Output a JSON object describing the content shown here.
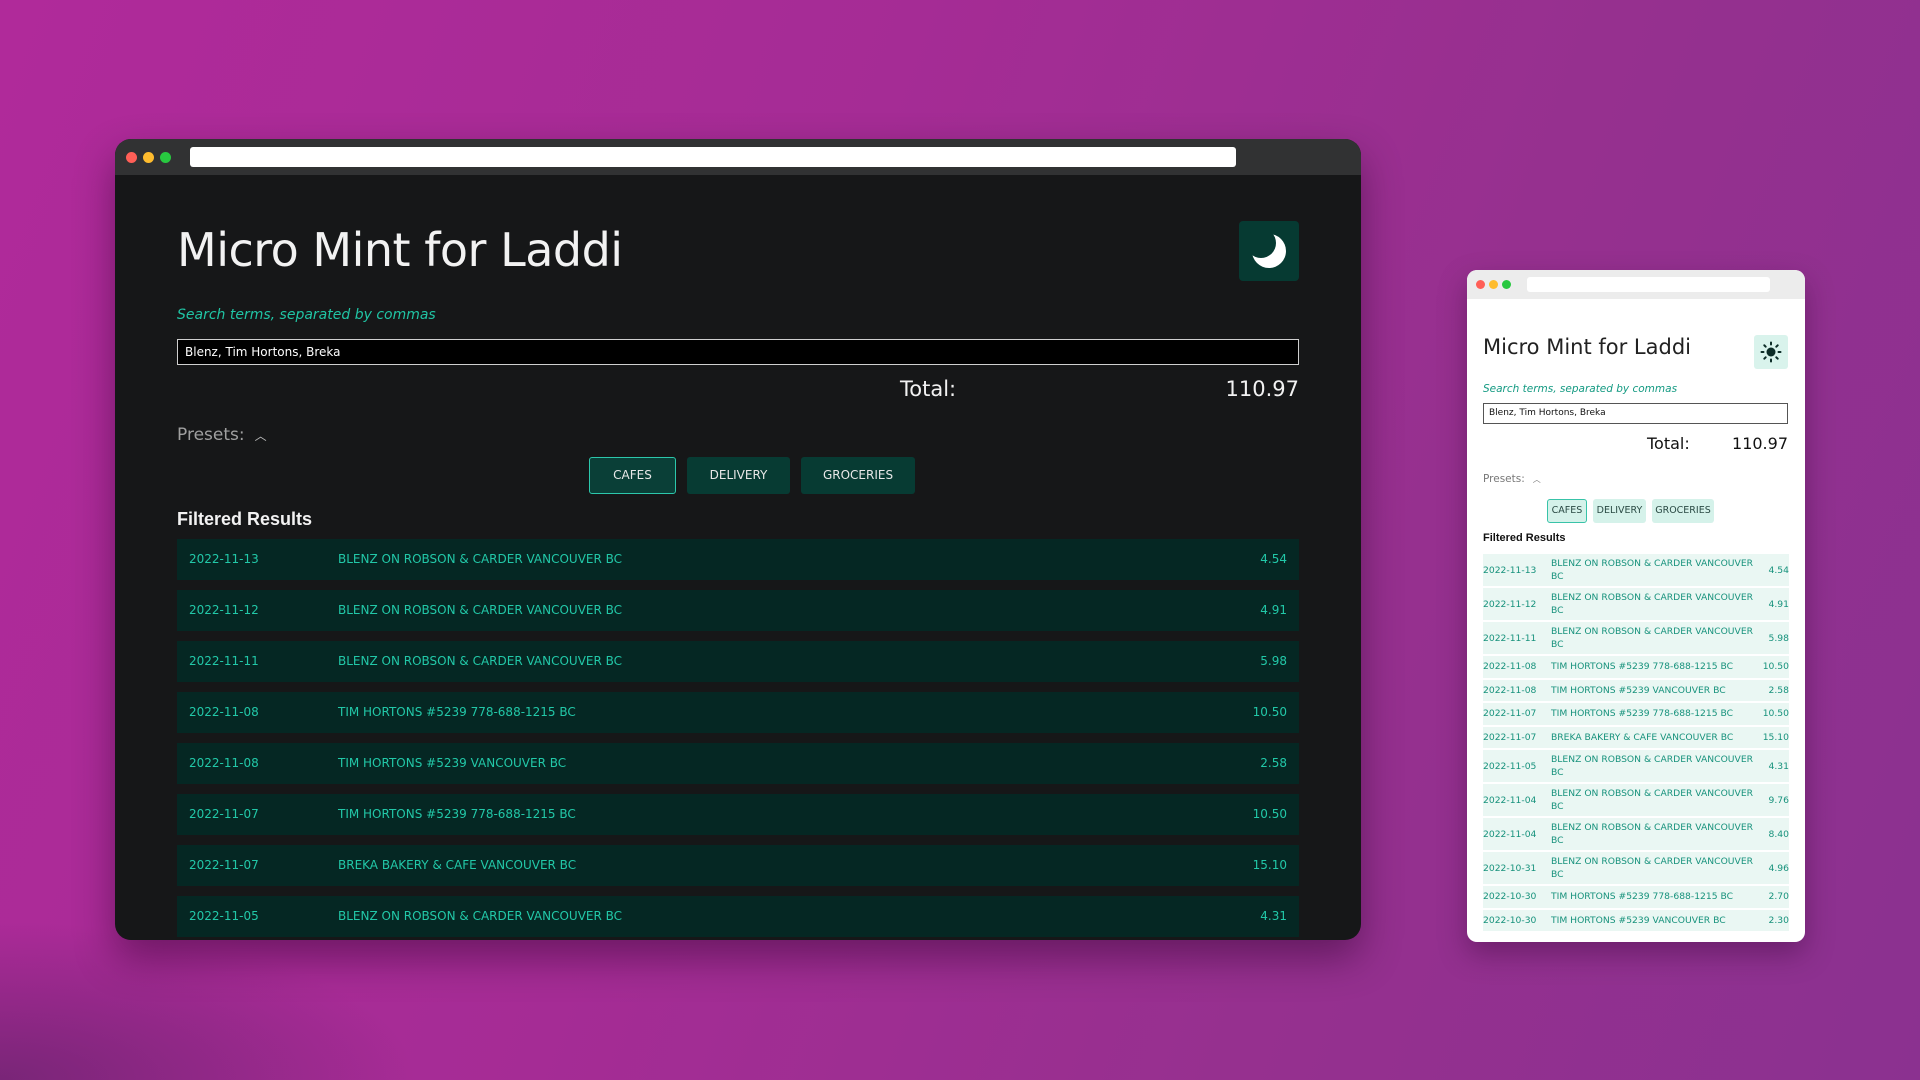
{
  "app": {
    "title": "Micro Mint for Laddi",
    "search_hint": "Search terms, separated by commas",
    "search_value": "Blenz, Tim Hortons, Breka",
    "total_label": "Total:",
    "total_value": "110.97",
    "presets_label": "Presets:",
    "presets_toggle_icon": "chevron-up-icon",
    "preset_buttons": [
      "CAFES",
      "DELIVERY",
      "GROCERIES"
    ],
    "active_preset": "CAFES",
    "results_title": "Filtered Results"
  },
  "dark_theme_icon": "moon-icon",
  "light_theme_icon": "sun-icon",
  "colors": {
    "background_gradient": [
      "#b02a9a",
      "#8b3190"
    ],
    "dark_bg": "#161718",
    "dark_row_bg": "#052723",
    "accent": "#22c8a8",
    "button_bg": "#073b33",
    "light_button_bg": "#d5f2ea",
    "light_row_bg": "#eaf7f3"
  },
  "dark_rows": [
    {
      "date": "2022-11-13",
      "desc": "BLENZ ON ROBSON & CARDER VANCOUVER BC",
      "amount": "4.54"
    },
    {
      "date": "2022-11-12",
      "desc": "BLENZ ON ROBSON & CARDER VANCOUVER BC",
      "amount": "4.91"
    },
    {
      "date": "2022-11-11",
      "desc": "BLENZ ON ROBSON & CARDER VANCOUVER BC",
      "amount": "5.98"
    },
    {
      "date": "2022-11-08",
      "desc": "TIM HORTONS #5239 778-688-1215 BC",
      "amount": "10.50"
    },
    {
      "date": "2022-11-08",
      "desc": "TIM HORTONS #5239 VANCOUVER BC",
      "amount": "2.58"
    },
    {
      "date": "2022-11-07",
      "desc": "TIM HORTONS #5239 778-688-1215 BC",
      "amount": "10.50"
    },
    {
      "date": "2022-11-07",
      "desc": "BREKA BAKERY & CAFE VANCOUVER BC",
      "amount": "15.10"
    },
    {
      "date": "2022-11-05",
      "desc": "BLENZ ON ROBSON & CARDER VANCOUVER BC",
      "amount": "4.31"
    }
  ],
  "light_rows": [
    {
      "date": "2022-11-13",
      "desc": "BLENZ ON ROBSON & CARDER VANCOUVER BC",
      "amount": "4.54"
    },
    {
      "date": "2022-11-12",
      "desc": "BLENZ ON ROBSON & CARDER VANCOUVER BC",
      "amount": "4.91"
    },
    {
      "date": "2022-11-11",
      "desc": "BLENZ ON ROBSON & CARDER VANCOUVER BC",
      "amount": "5.98"
    },
    {
      "date": "2022-11-08",
      "desc": "TIM HORTONS #5239 778-688-1215 BC",
      "amount": "10.50"
    },
    {
      "date": "2022-11-08",
      "desc": "TIM HORTONS #5239 VANCOUVER BC",
      "amount": "2.58"
    },
    {
      "date": "2022-11-07",
      "desc": "TIM HORTONS #5239 778-688-1215 BC",
      "amount": "10.50"
    },
    {
      "date": "2022-11-07",
      "desc": "BREKA BAKERY & CAFE VANCOUVER BC",
      "amount": "15.10"
    },
    {
      "date": "2022-11-05",
      "desc": "BLENZ ON ROBSON & CARDER VANCOUVER BC",
      "amount": "4.31"
    },
    {
      "date": "2022-11-04",
      "desc": "BLENZ ON ROBSON & CARDER VANCOUVER BC",
      "amount": "9.76"
    },
    {
      "date": "2022-11-04",
      "desc": "BLENZ ON ROBSON & CARDER VANCOUVER BC",
      "amount": "8.40"
    },
    {
      "date": "2022-10-31",
      "desc": "BLENZ ON ROBSON & CARDER VANCOUVER BC",
      "amount": "4.96"
    },
    {
      "date": "2022-10-30",
      "desc": "TIM HORTONS #5239 778-688-1215 BC",
      "amount": "2.70"
    },
    {
      "date": "2022-10-30",
      "desc": "TIM HORTONS #5239 VANCOUVER BC",
      "amount": "2.30"
    }
  ]
}
